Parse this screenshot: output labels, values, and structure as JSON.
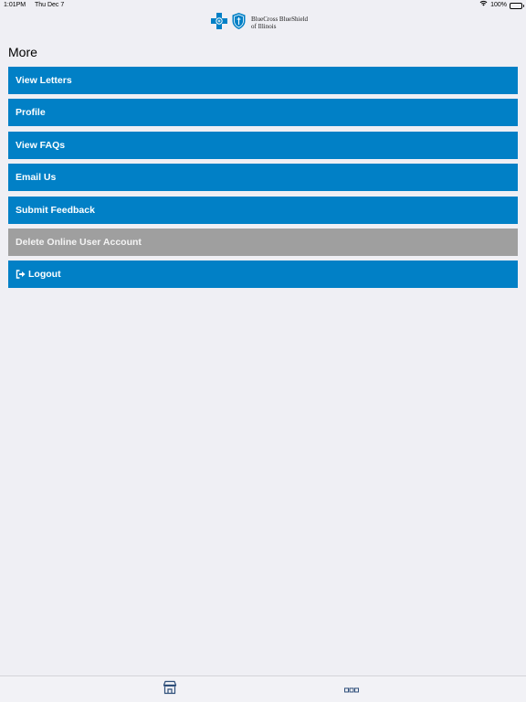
{
  "status_bar": {
    "time": "1:01PM",
    "date": "Thu Dec 7",
    "battery_percent": "100%",
    "battery_level": 1.0
  },
  "header": {
    "logo_line1": "BlueCross BlueShield",
    "logo_line2": "of Illinois",
    "brand_color": "#0180c6"
  },
  "page": {
    "title": "More"
  },
  "menu": {
    "items": [
      {
        "label": "View Letters",
        "enabled": true
      },
      {
        "label": "Profile",
        "enabled": true
      },
      {
        "label": "View FAQs",
        "enabled": true
      },
      {
        "label": "Email Us",
        "enabled": true
      },
      {
        "label": "Submit Feedback",
        "enabled": true
      },
      {
        "label": "Delete Online User Account",
        "enabled": false
      },
      {
        "label": "Logout",
        "enabled": true,
        "icon": "sign-out-icon"
      }
    ],
    "button_color": "#0180c6",
    "disabled_color": "#9f9f9f"
  },
  "tab_bar": {
    "tabs": [
      {
        "icon": "storefront-icon"
      },
      {
        "icon": "more-dots-icon"
      }
    ],
    "icon_color": "#2f4f7a"
  }
}
